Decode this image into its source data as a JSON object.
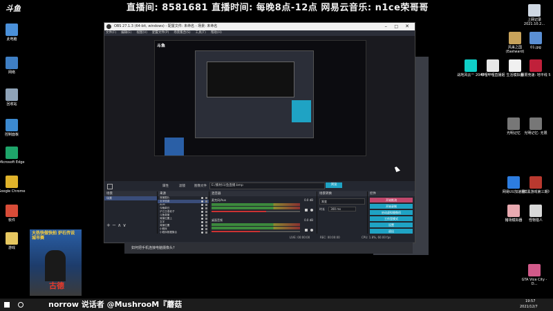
{
  "banner": {
    "text": "直播间: 8581681 直播时间: 每晚8点-12点 网易云音乐: n1ce荣哥哥"
  },
  "logo": {
    "text": "斗鱼"
  },
  "desktop_left": [
    {
      "label": "此电脑",
      "color": "#4a90d9",
      "icon": "pc-icon"
    },
    {
      "label": "网络",
      "color": "#3f7fc4",
      "icon": "network-icon"
    },
    {
      "label": "回收站",
      "color": "#8fa3b8",
      "icon": "recycle-bin-icon"
    },
    {
      "label": "控制面板",
      "color": "#3c8ad0",
      "icon": "control-panel-icon"
    },
    {
      "label": "Microsoft Edge",
      "color": "#1ea56a",
      "icon": "edge-icon"
    },
    {
      "label": "Google Chrome",
      "color": "#e0b32b",
      "icon": "chrome-icon"
    },
    {
      "label": "软件",
      "color": "#d84c38",
      "icon": "software-folder-icon"
    },
    {
      "label": "游戏",
      "color": "#e6c760",
      "icon": "games-folder-icon"
    }
  ],
  "desktop_right": [
    {
      "label": "上网记录 2021.10.2...",
      "color": "#cfd8e3",
      "icon": "file-icon"
    },
    {
      "label": "风来之国 (Eastward)",
      "color": "#c8a35b",
      "icon": "eastward-icon"
    },
    {
      "label": "01.jpg",
      "color": "#5a8fd4",
      "icon": "image-file-icon"
    },
    {
      "label": "战地风云™ 2042",
      "color": "#0fd0c8",
      "icon": "battlefield-icon"
    },
    {
      "label": "哔哩哔哩直播姬",
      "color": "#e8e8e8",
      "icon": "bilibili-icon"
    },
    {
      "label": "生活模拟器",
      "color": "#f0f0f0",
      "icon": "doc-icon"
    },
    {
      "label": "极限竞速: 地平线 5",
      "color": "#c0203a",
      "icon": "forza-icon"
    },
    {
      "label": "光明记忆",
      "color": "#777",
      "icon": "bright-memory-icon"
    },
    {
      "label": "光明记忆: 无限",
      "color": "#777",
      "icon": "bright-memory-infinite-icon"
    },
    {
      "label": "网易UU加速器",
      "color": "#2d7de0",
      "icon": "uu-icon"
    },
    {
      "label": "《摸黑游戏第三期》",
      "color": "#b9392f",
      "icon": "game-shortcut-icon"
    },
    {
      "label": "猪场模拟器",
      "color": "#e8a9b0",
      "icon": "pig-icon"
    },
    {
      "label": "怪物猎人",
      "color": "#d8d8d8",
      "icon": "mh-icon"
    },
    {
      "label": "GTA Vice City - D...",
      "color": "#d15a8a",
      "icon": "gta-icon"
    }
  ],
  "obs": {
    "title": "OBS 27.1.3 (64-bit, windows) - 配置文件: 未命名 - 场景: 未命名",
    "menu": [
      "文件(F)",
      "编辑(E)",
      "视图(V)",
      "配置文件(P)",
      "场景集合(S)",
      "工具(T)",
      "帮助(H)"
    ],
    "source_bar": {
      "properties": "属性",
      "filters": "滤镜",
      "image_file": "图像文件",
      "path": "E:/素材/斗鱼直播.bmp",
      "browse": "浏览"
    },
    "scenes_header": "场景",
    "scene_item": "场景",
    "sources_header": "来源",
    "sources": [
      "背景图片",
      "文字信息",
      "ALM",
      "今晚单日",
      "沪江日语老子",
      "斗鱼背景",
      "背景位置上",
      "文字",
      "背景位置",
      "小程序",
      "小程序数据集合",
      "游戏直播"
    ],
    "mixer_header": "混音器",
    "mixer": [
      {
        "name": "麦克风/Aux",
        "db": "0.0 dB",
        "level": 0.62
      },
      {
        "name": "桌面音频",
        "db": "0.0 dB",
        "level": 0.55
      }
    ],
    "transition_header": "场景转换",
    "transition_type": "渐变",
    "transition_duration_label": "时长",
    "transition_duration": "300 ms",
    "controls_header": "控件",
    "controls": [
      "开始推流",
      "开始录制",
      "启动虚拟摄像机",
      "工作室模式",
      "设置",
      "退出"
    ],
    "status": {
      "live": "LIVE: 00:00:00",
      "rec": "REC: 00:00:00",
      "cpu": "CPU: 1.8%, 60.00 fps"
    }
  },
  "popup": {
    "text": "如何把手机连接电脑摄像头?"
  },
  "ticker": {
    "text": "norrow 说话者 @MushrooM『蘑菇"
  },
  "clock": {
    "time": "19:57",
    "date": "2021/12/7"
  },
  "webcam_label": "古德",
  "webcam_header": "大热快做快拍 炉石传说 城市赛"
}
